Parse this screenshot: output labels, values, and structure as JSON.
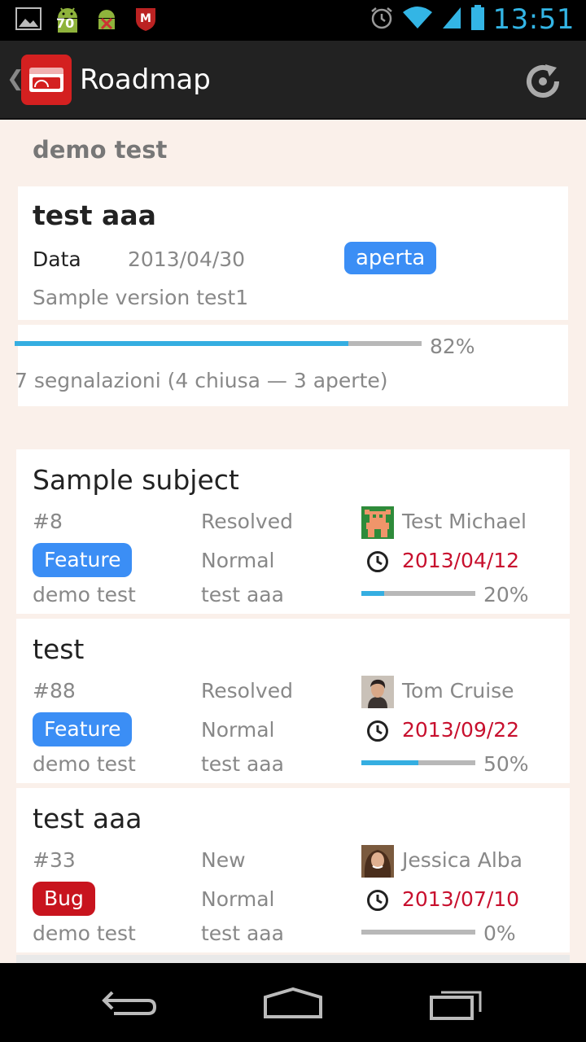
{
  "status_bar": {
    "time": "13:51",
    "notification_badge": "70",
    "icons": [
      "image-icon",
      "android-update-icon",
      "android-blocked-icon",
      "mcafee-icon",
      "alarm-icon",
      "wifi-icon",
      "signal-icon",
      "battery-icon"
    ]
  },
  "action_bar": {
    "title": "Roadmap",
    "brand_color": "#d42020"
  },
  "section": {
    "title": "demo test"
  },
  "version": {
    "name": "test aaa",
    "date_label": "Data",
    "date": "2013/04/30",
    "status": "aperta",
    "description": "Sample version test1",
    "progress_fraction": 0.82,
    "progress_text": "82%",
    "summary": "7 segnalazioni (4 chiusa — 3 aperte)"
  },
  "issues": [
    {
      "subject": "Sample subject",
      "id": "#8",
      "status": "Resolved",
      "assignee": "Test Michael",
      "tracker": "Feature",
      "tracker_color": "#3b8ef5",
      "priority": "Normal",
      "due": "2013/04/12",
      "project": "demo test",
      "version": "test aaa",
      "progress_fraction": 0.2,
      "progress_text": "20%"
    },
    {
      "subject": "test",
      "id": "#88",
      "status": "Resolved",
      "assignee": "Tom Cruise",
      "tracker": "Feature",
      "tracker_color": "#3b8ef5",
      "priority": "Normal",
      "due": "2013/09/22",
      "project": "demo test",
      "version": "test aaa",
      "progress_fraction": 0.5,
      "progress_text": "50%"
    },
    {
      "subject": "test aaa",
      "id": "#33",
      "status": "New",
      "assignee": "Jessica Alba",
      "tracker": "Bug",
      "tracker_color": "#c8141e",
      "priority": "Normal",
      "due": "2013/07/10",
      "project": "demo test",
      "version": "test aaa",
      "progress_fraction": 0.0,
      "progress_text": "0%"
    }
  ],
  "colors": {
    "accent": "#33b5e5",
    "progress": "#35aee1",
    "due_date": "#c8102e",
    "background": "#faf0ea"
  }
}
